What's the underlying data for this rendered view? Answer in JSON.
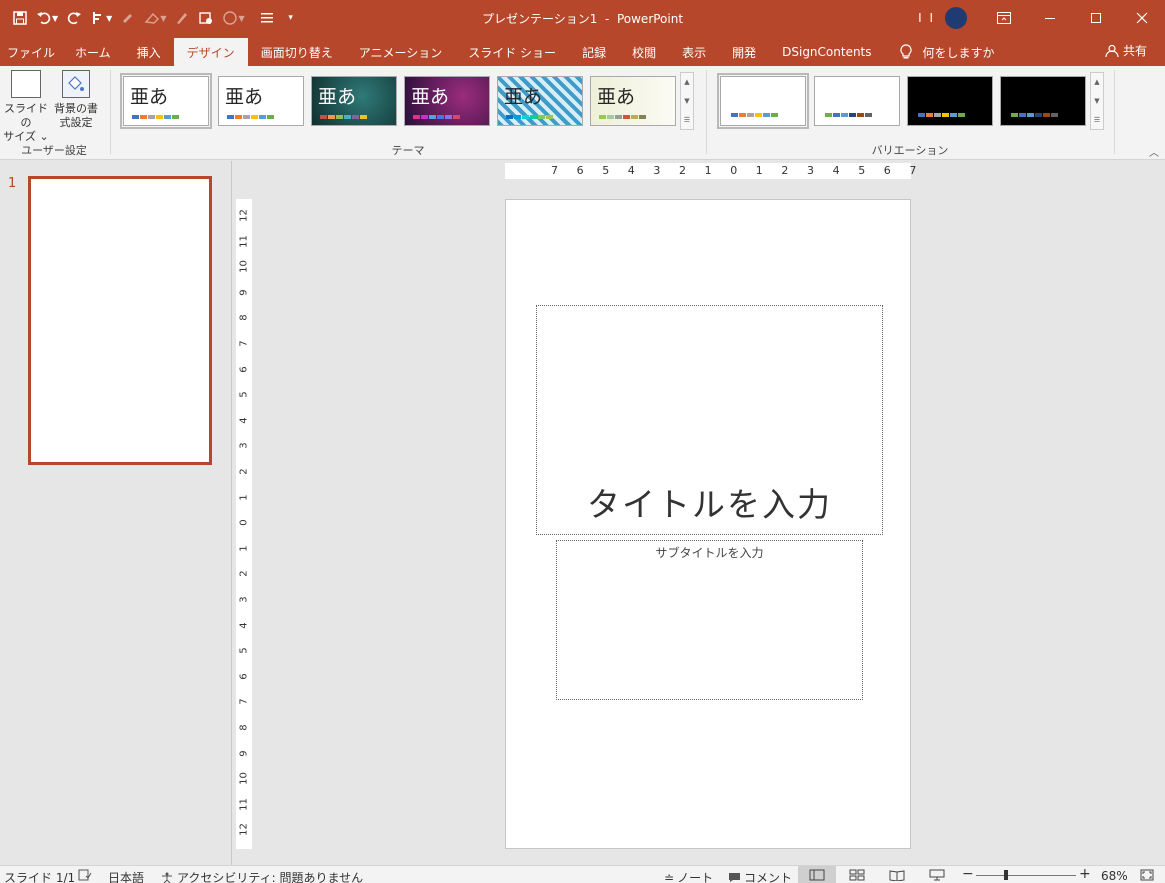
{
  "window": {
    "doc_title": "プレゼンテーション1",
    "app_name": "PowerPoint",
    "title_separator": "-"
  },
  "quick_access": [
    "save-icon",
    "undo-icon",
    "redo-icon",
    "touch-mode-icon",
    "format-painter-icon",
    "eraser-icon",
    "highlighter-icon",
    "record-icon",
    "shapes-icon",
    "align-icon",
    "customize-icon"
  ],
  "tabs": [
    {
      "id": "file",
      "label": "ファイル"
    },
    {
      "id": "home",
      "label": "ホーム"
    },
    {
      "id": "insert",
      "label": "挿入"
    },
    {
      "id": "design",
      "label": "デザイン",
      "active": true
    },
    {
      "id": "transitions",
      "label": "画面切り替え"
    },
    {
      "id": "animations",
      "label": "アニメーション"
    },
    {
      "id": "slideshow",
      "label": "スライド ショー"
    },
    {
      "id": "record",
      "label": "記録"
    },
    {
      "id": "review",
      "label": "校閲"
    },
    {
      "id": "view",
      "label": "表示"
    },
    {
      "id": "developer",
      "label": "開発"
    },
    {
      "id": "dsign",
      "label": "DSignContents"
    }
  ],
  "tell_me": "何をしますか",
  "share": "共有",
  "ribbon": {
    "customize_group": {
      "label": "ユーザー設定",
      "slide_size": {
        "line1": "スライドの",
        "line2": "サイズ ⌄"
      },
      "format_bg": {
        "line1": "背景の書",
        "line2": "式設定"
      }
    },
    "themes_group": {
      "label": "テーマ",
      "sample_text": "亜あ",
      "themes": [
        {
          "bg": "#ffffff",
          "fg": "#262626",
          "colors": [
            "#4472c4",
            "#ed7d31",
            "#a5a5a5",
            "#ffc000",
            "#5b9bd5",
            "#70ad47"
          ]
        },
        {
          "bg": "#ffffff",
          "fg": "#262626",
          "colors": [
            "#4472c4",
            "#ed7d31",
            "#a5a5a5",
            "#ffc000",
            "#5b9bd5",
            "#70ad47"
          ]
        },
        {
          "bg": "#1f4e4f",
          "fg": "#ffffff",
          "colors": [
            "#c0504d",
            "#f79646",
            "#9bbb59",
            "#4bacc6",
            "#8064a2",
            "#f2c314"
          ]
        },
        {
          "bg": "#3c1a4a",
          "fg": "#ffffff",
          "colors": [
            "#e32d91",
            "#c830cc",
            "#4ea6dc",
            "#4775e7",
            "#8971e1",
            "#d54773"
          ]
        },
        {
          "bg": "#e9f3f8",
          "fg": "#262626",
          "colors": [
            "#0f6fc6",
            "#009dd9",
            "#0bd0d9",
            "#10cf9b",
            "#7cca62",
            "#a5c249"
          ]
        },
        {
          "bg": "#f7f7ea",
          "fg": "#262626",
          "colors": [
            "#94c954",
            "#a9c7a0",
            "#93a299",
            "#cf543f",
            "#b5ae53",
            "#848058"
          ]
        }
      ]
    },
    "variants_group": {
      "label": "バリエーション",
      "variants": [
        {
          "bg": "#ffffff",
          "colors": [
            "#4472c4",
            "#ed7d31",
            "#a5a5a5",
            "#ffc000",
            "#5b9bd5",
            "#70ad47"
          ]
        },
        {
          "bg": "#ffffff",
          "colors": [
            "#70ad47",
            "#4472c4",
            "#5b9bd5",
            "#264478",
            "#9e480e",
            "#636363"
          ]
        },
        {
          "bg": "#000000",
          "colors": [
            "#4472c4",
            "#ed7d31",
            "#a5a5a5",
            "#ffc000",
            "#5b9bd5",
            "#70ad47"
          ]
        },
        {
          "bg": "#000000",
          "colors": [
            "#70ad47",
            "#4472c4",
            "#5b9bd5",
            "#264478",
            "#9e480e",
            "#636363"
          ]
        }
      ]
    }
  },
  "thumbnail": {
    "number": "1"
  },
  "rulers": {
    "horizontal": [
      "7",
      "6",
      "5",
      "4",
      "3",
      "2",
      "1",
      "0",
      "1",
      "2",
      "3",
      "4",
      "5",
      "6",
      "7"
    ],
    "vertical": [
      "12",
      "11",
      "10",
      "9",
      "8",
      "7",
      "6",
      "5",
      "4",
      "3",
      "2",
      "1",
      "0",
      "1",
      "2",
      "3",
      "4",
      "5",
      "6",
      "7",
      "8",
      "9",
      "10",
      "11",
      "12"
    ]
  },
  "slide": {
    "title_placeholder": "タイトルを入力",
    "subtitle_placeholder": "サブタイトルを入力"
  },
  "status": {
    "slide_info": "スライド 1/1",
    "language": "日本語",
    "accessibility": "アクセシビリティ: 問題ありません",
    "notes": "ノート",
    "comments": "コメント",
    "zoom": "68%",
    "zoom_level": 0.3
  }
}
